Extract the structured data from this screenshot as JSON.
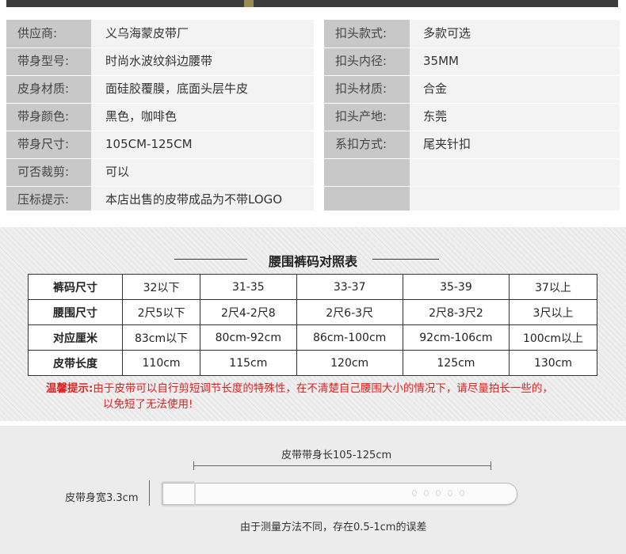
{
  "specs": {
    "left": [
      {
        "label": "供应商:",
        "value": "义乌海蒙皮带厂"
      },
      {
        "label": "带身型号:",
        "value": "时尚水波纹斜边腰带"
      },
      {
        "label": "皮身材质:",
        "value": "面硅胶覆膜，底面头层牛皮"
      },
      {
        "label": "带身颜色:",
        "value": "黑色，咖啡色"
      },
      {
        "label": "带身尺寸:",
        "value": "105CM-125CM"
      },
      {
        "label": "可否裁剪:",
        "value": "可以"
      },
      {
        "label": "压标提示:",
        "value": "本店出售的皮带成品为不带LOGO"
      }
    ],
    "right": [
      {
        "label": "扣头款式:",
        "value": "多款可选"
      },
      {
        "label": "扣头内径:",
        "value": "35MM"
      },
      {
        "label": "扣头材质:",
        "value": "合金"
      },
      {
        "label": "扣头产地:",
        "value": "东莞"
      },
      {
        "label": "系扣方式:",
        "value": "尾夹针扣"
      }
    ]
  },
  "size_chart": {
    "title": "腰围裤码对照表",
    "rows": [
      {
        "header": "裤码尺寸",
        "cells": [
          "32以下",
          "31-35",
          "33-37",
          "35-39",
          "37以上"
        ]
      },
      {
        "header": "腰围尺寸",
        "cells": [
          "2尺5以下",
          "2尺4-2尺8",
          "2尺6-3尺",
          "2尺8-3尺2",
          "3尺以上"
        ]
      },
      {
        "header": "对应厘米",
        "cells": [
          "83cm以下",
          "80cm-92cm",
          "86cm-100cm",
          "92cm-106cm",
          "100cm以上"
        ]
      },
      {
        "header": "皮带长度",
        "cells": [
          "110cm",
          "115cm",
          "120cm",
          "125cm",
          "130cm"
        ]
      }
    ],
    "warning_label": "温馨提示:",
    "warning_line1": "由于皮带可以自行剪短调节长度的特殊性，在不清楚自己腰围大小的情况下，请尽量拍长一些的，",
    "warning_line2": "以免短了无法使用!"
  },
  "belt_diagram": {
    "length_label": "皮带带身长105-125cm",
    "width_label": "皮带身宽3.3cm",
    "error_note": "由于测量方法不同，存在0.5-1cm的误差"
  },
  "colors": {
    "label_bg": "#c8c8c8",
    "value_bg": "#f3f3f3",
    "warning_red": "#e12020"
  }
}
